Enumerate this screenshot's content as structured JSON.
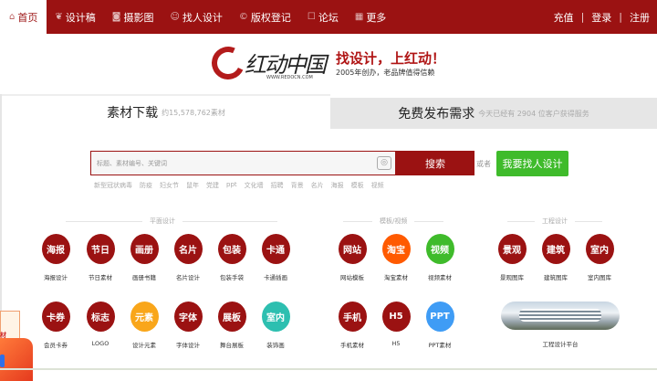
{
  "nav": {
    "items": [
      {
        "label": "首页",
        "icon": "home-icon"
      },
      {
        "label": "设计稿",
        "icon": "leaf-icon"
      },
      {
        "label": "摄影图",
        "icon": "camera-icon"
      },
      {
        "label": "找人设计",
        "icon": "person-icon"
      },
      {
        "label": "版权登记",
        "icon": "copyright-icon"
      },
      {
        "label": "论坛",
        "icon": "chat-icon"
      },
      {
        "label": "更多",
        "icon": "grid-icon"
      }
    ],
    "recharge": "充值",
    "login": "登录",
    "register": "注册",
    "sep": "|"
  },
  "logo": {
    "brand": "红动中国",
    "url": "WWW.REDOCN.COM",
    "slogan": "找设计，上红动！",
    "tagline": "2005年创办，老品牌值得信赖"
  },
  "tabs": {
    "left": {
      "title": "素材下载",
      "sub": "约15,578,762素材"
    },
    "right": {
      "title": "免费发布需求",
      "sub": "今天已经有 2904 位客户获得服务"
    }
  },
  "search": {
    "placeholder": "标题、素材编号、关键词",
    "button": "搜索",
    "or": "或者",
    "find_designer": "我要找人设计",
    "hot": [
      "新型冠状病毒",
      "防疫",
      "妇女节",
      "鼠年",
      "党建",
      "ppt",
      "文化墙",
      "招聘",
      "背景",
      "名片",
      "海报",
      "模板",
      "视频"
    ]
  },
  "sections": {
    "flat": "平面设计",
    "template": "模板/视频",
    "engineering": "工程设计"
  },
  "colors": {
    "red": "#9b1212",
    "orange": "#ff5a00",
    "green": "#3fbb2b",
    "yellow": "#f9a61a",
    "teal": "#2dbfb0",
    "blue": "#3f9cf5"
  },
  "categories": [
    {
      "icon": "海报",
      "label": "海报设计",
      "color": "#9b1212"
    },
    {
      "icon": "节日",
      "label": "节日素材",
      "color": "#9b1212"
    },
    {
      "icon": "画册",
      "label": "画册书籍",
      "color": "#9b1212"
    },
    {
      "icon": "名片",
      "label": "名片设计",
      "color": "#9b1212"
    },
    {
      "icon": "包装",
      "label": "包装手袋",
      "color": "#9b1212"
    },
    {
      "icon": "卡通",
      "label": "卡通插画",
      "color": "#9b1212"
    },
    {
      "icon": "网站",
      "label": "网站模板",
      "color": "#9b1212"
    },
    {
      "icon": "淘宝",
      "label": "淘宝素材",
      "color": "#ff5a00"
    },
    {
      "icon": "视频",
      "label": "视频素材",
      "color": "#3fbb2b"
    },
    {
      "icon": "景观",
      "label": "景观图库",
      "color": "#9b1212"
    },
    {
      "icon": "建筑",
      "label": "建筑图库",
      "color": "#9b1212"
    },
    {
      "icon": "室内",
      "label": "室内图库",
      "color": "#9b1212"
    },
    {
      "icon": "卡券",
      "label": "会员卡券",
      "color": "#9b1212"
    },
    {
      "icon": "标志",
      "label": "LOGO",
      "color": "#9b1212"
    },
    {
      "icon": "元素",
      "label": "设计元素",
      "color": "#f9a61a"
    },
    {
      "icon": "字体",
      "label": "字体设计",
      "color": "#9b1212"
    },
    {
      "icon": "展板",
      "label": "舞台展板",
      "color": "#9b1212"
    },
    {
      "icon": "室内",
      "label": "装饰画",
      "color": "#2dbfb0"
    },
    {
      "icon": "手机",
      "label": "手机素材",
      "color": "#9b1212"
    },
    {
      "icon": "H5",
      "label": "H5",
      "color": "#9b1212"
    },
    {
      "icon": "PPT",
      "label": "PPT素材",
      "color": "#3f9cf5"
    }
  ],
  "engineering_platform": "工程设计平台",
  "ad": {
    "text": "材"
  }
}
